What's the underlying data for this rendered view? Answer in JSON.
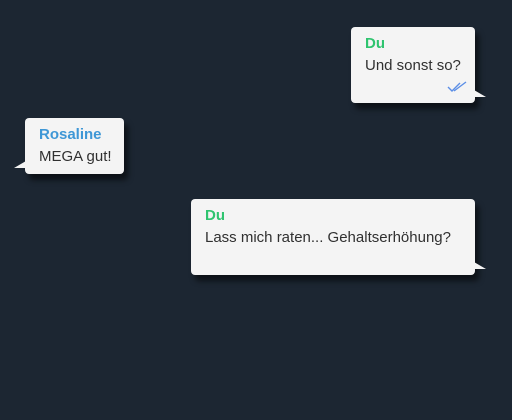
{
  "colors": {
    "background": "#1c2632",
    "bubble": "#f4f4f4",
    "sender_self": "#2fc46f",
    "sender_other": "#3e97d6",
    "read_ticks": "#5b8ee6"
  },
  "messages": [
    {
      "sender": "Du",
      "text": "Und sonst so?",
      "direction": "outgoing",
      "status_icon": "double-check-icon"
    },
    {
      "sender": "Rosaline",
      "text": "MEGA gut!",
      "direction": "incoming"
    },
    {
      "sender": "Du",
      "text": "Lass mich raten... Gehaltserhöhung?",
      "direction": "outgoing"
    }
  ]
}
